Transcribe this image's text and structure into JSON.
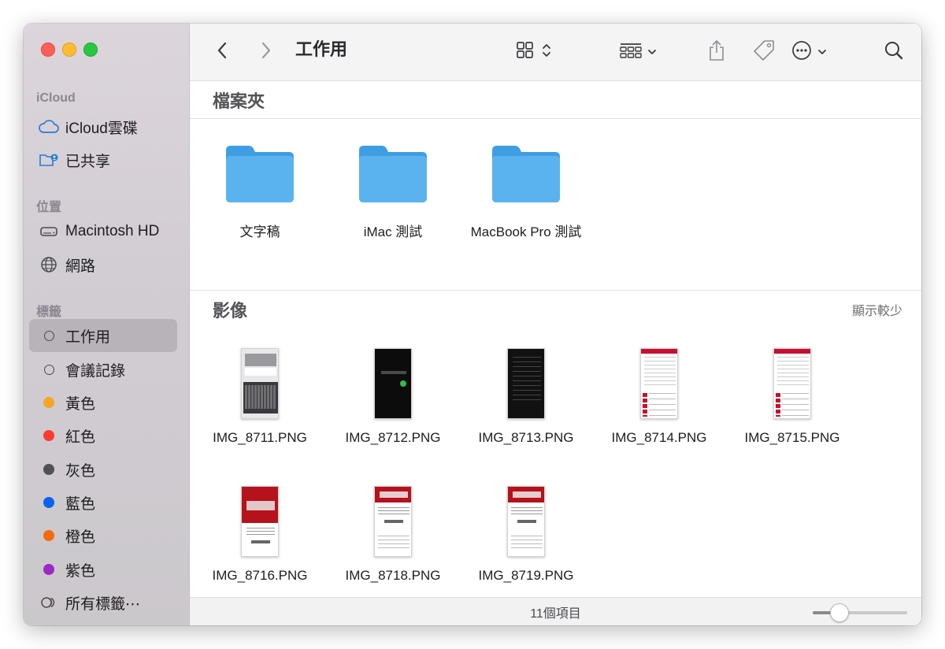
{
  "toolbar": {
    "title": "工作用",
    "icons": [
      "chevron-left-icon",
      "chevron-right-icon",
      "grid-view-icon",
      "group-by-icon",
      "share-icon",
      "tag-icon",
      "more-icon",
      "search-icon"
    ]
  },
  "sidebar": {
    "sections": [
      {
        "title": "iCloud",
        "items": [
          {
            "label": "iCloud雲碟",
            "icon": "cloud-icon"
          },
          {
            "label": "已共享",
            "icon": "shared-folder-icon"
          }
        ]
      },
      {
        "title": "位置",
        "items": [
          {
            "label": "Macintosh HD",
            "icon": "disk-icon"
          },
          {
            "label": "網路",
            "icon": "network-globe-icon"
          }
        ]
      },
      {
        "title": "標籤",
        "items": [
          {
            "label": "工作用",
            "icon": "tag-ring-icon",
            "selected": true
          },
          {
            "label": "會議記錄",
            "icon": "tag-ring-icon"
          },
          {
            "label": "黃色",
            "icon": "tag-dot-icon",
            "color": "#f5a623"
          },
          {
            "label": "紅色",
            "icon": "tag-dot-icon",
            "color": "#ff3b30"
          },
          {
            "label": "灰色",
            "icon": "tag-dot-icon",
            "color": "#505055"
          },
          {
            "label": "藍色",
            "icon": "tag-dot-icon",
            "color": "#0a62f2"
          },
          {
            "label": "橙色",
            "icon": "tag-dot-icon",
            "color": "#f56a0d"
          },
          {
            "label": "紫色",
            "icon": "tag-dot-icon",
            "color": "#9d27c7"
          },
          {
            "label": "所有標籤⋯",
            "icon": "all-tags-icon"
          }
        ]
      }
    ]
  },
  "groups": {
    "folders": {
      "title": "檔案夾",
      "items": [
        {
          "name": "文字稿"
        },
        {
          "name": "iMac 測試"
        },
        {
          "name": "MacBook Pro 測試"
        }
      ]
    },
    "images": {
      "title": "影像",
      "action": "顯示較少",
      "items": [
        {
          "name": "IMG_8711.PNG",
          "style": "keyboard"
        },
        {
          "name": "IMG_8712.PNG",
          "style": "dark"
        },
        {
          "name": "IMG_8713.PNG",
          "style": "dark-list"
        },
        {
          "name": "IMG_8714.PNG",
          "style": "light-list"
        },
        {
          "name": "IMG_8715.PNG",
          "style": "light-list"
        },
        {
          "name": "IMG_8716.PNG",
          "style": "poster"
        },
        {
          "name": "IMG_8718.PNG",
          "style": "poster-small"
        },
        {
          "name": "IMG_8719.PNG",
          "style": "poster-small"
        }
      ]
    }
  },
  "status": {
    "text": "11個項目",
    "zoom": 0.28
  },
  "colors": {
    "folder": "#5ab3ee",
    "folder_tab": "#3f9de2",
    "selection": "#b8b3b9"
  }
}
